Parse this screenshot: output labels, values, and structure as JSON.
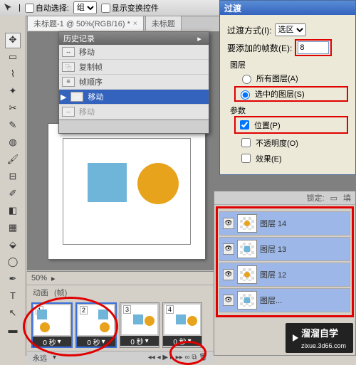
{
  "topbar": {
    "auto_select": "自动选择:",
    "group": "组",
    "show_transform": "显示变换控件"
  },
  "doc": {
    "title": "未标题-1 @ 50%(RGB/16) *",
    "tab2": "未标题"
  },
  "history": {
    "title": "历史记录",
    "items": [
      "移动",
      "复制帧",
      "帧顺序",
      "移动",
      "移动"
    ]
  },
  "dialog": {
    "title": "过渡",
    "method_label": "过渡方式(I):",
    "method_value": "选区",
    "frames_label": "要添加的帧数(E):",
    "frames_value": "8",
    "layers_title": "图层",
    "all_layers": "所有图层(A)",
    "sel_layers": "选中的图层(S)",
    "params_title": "参数",
    "pos": "位置(P)",
    "opacity": "不透明度(O)",
    "effects": "效果(E)"
  },
  "timeline": {
    "zoom": "50%",
    "tab_anim": "动画",
    "tab_frames": "(帧)",
    "time": "0 秒",
    "forever": "永远"
  },
  "layers": {
    "lock": "锁定:",
    "fill": "填",
    "items": [
      "图层 14",
      "图层 13",
      "图层 12",
      "图层..."
    ]
  },
  "watermark": {
    "text": "溜溜自学",
    "url": "zixue.3d66.com"
  }
}
